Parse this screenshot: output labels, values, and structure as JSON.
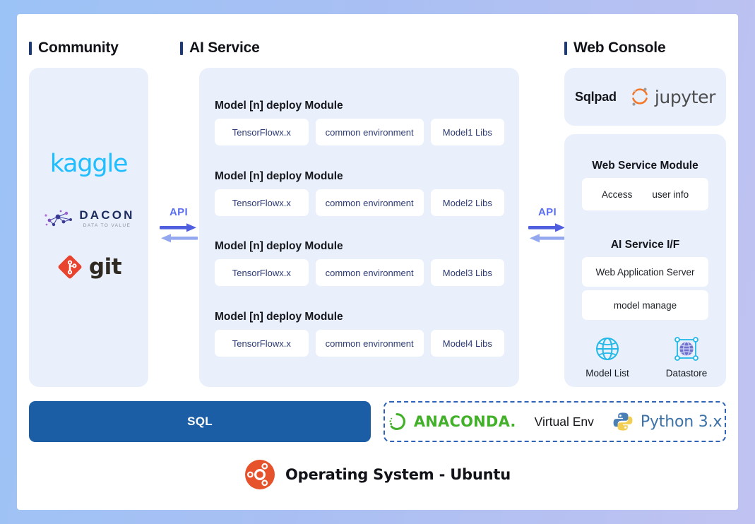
{
  "sections": {
    "community": {
      "title": "Community"
    },
    "ai_service": {
      "title": "AI Service"
    },
    "web_console": {
      "title": "Web Console"
    }
  },
  "community": {
    "logos": [
      {
        "name": "kaggle-logo",
        "label": "kaggle"
      },
      {
        "name": "dacon-logo",
        "label": "DACON",
        "tagline": "DATA TO VALUE"
      },
      {
        "name": "git-logo",
        "label": "git"
      }
    ]
  },
  "ai_service": {
    "modules": [
      {
        "title": "Model [n] deploy Module",
        "framework": "TensorFlowx.x",
        "environment": "common environment",
        "libs": "Model1 Libs"
      },
      {
        "title": "Model [n] deploy Module",
        "framework": "TensorFlowx.x",
        "environment": "common environment",
        "libs": "Model2 Libs"
      },
      {
        "title": "Model [n] deploy Module",
        "framework": "TensorFlowx.x",
        "environment": "common environment",
        "libs": "Model3 Libs"
      },
      {
        "title": "Model [n] deploy Module",
        "framework": "TensorFlowx.x",
        "environment": "common environment",
        "libs": "Model4 Libs"
      }
    ]
  },
  "connectors": {
    "left": {
      "label": "API"
    },
    "right": {
      "label": "API"
    }
  },
  "web_console": {
    "tools": {
      "sqlpad": "Sqlpad",
      "jupyter": "jupyter"
    },
    "web_service_module": {
      "title": "Web Service Module",
      "access": "Access",
      "user_info": "user info"
    },
    "ai_service_if": {
      "title": "AI Service I/F",
      "items": [
        "Web Application Server",
        "model manage"
      ]
    },
    "icons": [
      {
        "name": "globe-icon",
        "label": "Model List"
      },
      {
        "name": "datastore-globe-icon",
        "label": "Datastore"
      }
    ]
  },
  "bottom": {
    "sql": "SQL",
    "anaconda": "ANACONDA.",
    "virtual_env": "Virtual Env",
    "python": "Python 3.x",
    "os": "Operating System - Ubuntu"
  },
  "colors": {
    "accent_blue": "#1b5ea6",
    "api_arrow": "#4f5fe0",
    "api_arrow_light": "#93a8ef",
    "panel_bg": "#e9f0fc",
    "kaggle": "#20beff",
    "anaconda_green": "#43b02a",
    "python_blue": "#3b72a8",
    "ubuntu_orange": "#e6522c",
    "jupyter_orange": "#f37726",
    "globe_cyan": "#22b8e8",
    "datastore_purple": "#6f6fd0"
  }
}
